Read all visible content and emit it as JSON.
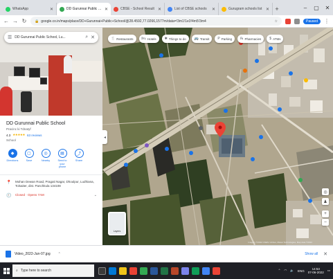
{
  "browser": {
    "tabs": [
      {
        "title": "WhatsApp",
        "color": "#25d366",
        "active": false
      },
      {
        "title": "DD Gurunnai Public Scho",
        "color": "#34a853",
        "active": true
      },
      {
        "title": "CBSE - School Result",
        "color": "#ea4335",
        "active": false
      },
      {
        "title": "List of CBSE schools",
        "color": "#4285f4",
        "active": false
      },
      {
        "title": "Gurugram schools list",
        "color": "#fbbc05",
        "active": false
      }
    ],
    "new_tab_label": "+",
    "address": "google.co.in/maps/place/DD+Gurunnai+Public+School/@28.4592,77.0266,1577m/data=!3m1!1e3!4m5!3m4",
    "profile_label": "Paused"
  },
  "panel": {
    "search_value": "DD Gurunnai Public School, Lu...",
    "place_name": "DD Gurunnai Public School",
    "subtitle": "Pracinc ki Tdnatyf",
    "rating": "4.3",
    "stars": "★★★★★",
    "reviews": "63 reviews",
    "place_type": "School",
    "actions": [
      {
        "icon": "◆",
        "label": "Directions",
        "name": "directions"
      },
      {
        "icon": "▢",
        "label": "Save",
        "name": "save"
      },
      {
        "icon": "◎",
        "label": "Nearby",
        "name": "nearby"
      },
      {
        "icon": "▤",
        "label": "Send to your phone",
        "name": "send-to-phone"
      },
      {
        "icon": "⤴",
        "label": "Share",
        "name": "share"
      }
    ],
    "address": "Mohan Dewan Road, Pragati Nagar, Dhoulpur, Ludhiana, Tolsaiter, dist. Panchkula 134108",
    "hours": "Closed · Opens 7AM",
    "hours_chevron": "⌄"
  },
  "map": {
    "chips": [
      {
        "icon": "🍴",
        "label": "Restaurants"
      },
      {
        "icon": "🛏",
        "label": "Hotels"
      },
      {
        "icon": "✱",
        "label": "Things to do"
      },
      {
        "icon": "🚌",
        "label": "Transit"
      },
      {
        "icon": "P",
        "label": "Parking"
      },
      {
        "icon": "℞",
        "label": "Pharmacies"
      },
      {
        "icon": "$",
        "label": "ATMs"
      }
    ],
    "layers_label": "Layers",
    "attribution": "Imagery ©2022 CNES / Airbus, Maxar Technologies, Map data ©2022"
  },
  "download": {
    "file_name": "Video_2022-Jun-07.jpg",
    "show_all": "Show all"
  },
  "taskbar": {
    "search_placeholder": "Type here to search",
    "time": "14:53",
    "date": "07-06-2022",
    "lang": "ENG"
  }
}
